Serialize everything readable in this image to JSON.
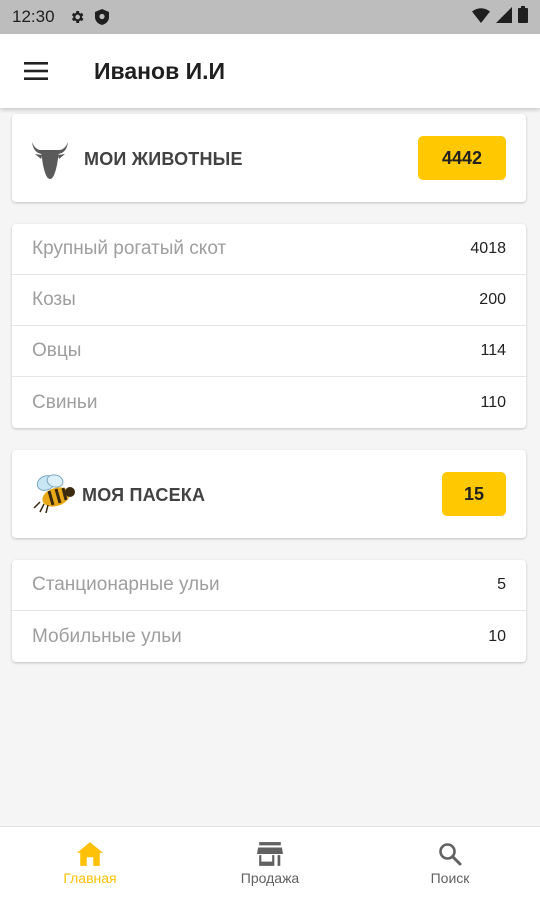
{
  "status_bar": {
    "time": "12:30"
  },
  "header": {
    "title": "Иванов И.И"
  },
  "animals": {
    "title": "МОИ ЖИВОТНЫЕ",
    "total": "4442",
    "items": [
      {
        "label": "Крупный рогатый скот",
        "value": "4018"
      },
      {
        "label": "Козы",
        "value": "200"
      },
      {
        "label": "Овцы",
        "value": "114"
      },
      {
        "label": "Свиньи",
        "value": "110"
      }
    ]
  },
  "apiary": {
    "title": "МОЯ ПАСЕКА",
    "total": "15",
    "items": [
      {
        "label": "Станционарные ульи",
        "value": "5"
      },
      {
        "label": "Мобильные ульи",
        "value": "10"
      }
    ]
  },
  "bottom_nav": [
    {
      "label": "Главная",
      "icon": "home-icon",
      "active": true
    },
    {
      "label": "Продажа",
      "icon": "store-icon",
      "active": false
    },
    {
      "label": "Поиск",
      "icon": "search-icon",
      "active": false
    }
  ],
  "colors": {
    "accent": "#ffc800",
    "active_nav": "#ffc107",
    "status_bar": "#bdbdbd"
  }
}
